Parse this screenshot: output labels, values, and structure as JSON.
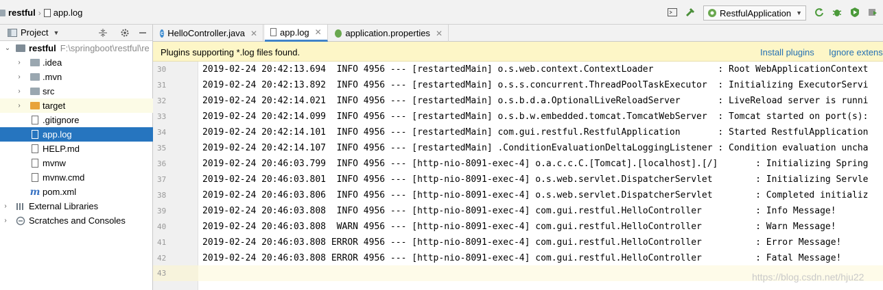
{
  "breadcrumb": {
    "project": "restful",
    "file": "app.log"
  },
  "toolbar": {
    "run_config": "RestfulApplication",
    "icons": [
      "terminal-icon",
      "build-icon",
      "rerun-icon",
      "debug-icon",
      "coverage-icon",
      "stop-icon"
    ]
  },
  "project_panel": {
    "title": "Project",
    "header_icons": [
      "collapse-all-icon",
      "settings-gear-icon",
      "hide-panel-icon"
    ],
    "tree": [
      {
        "label": "restful",
        "path": "F:\\springboot\\restful\\re",
        "icon": "module-folder-icon",
        "expanded": true,
        "level": 0
      },
      {
        "label": ".idea",
        "icon": "folder-icon",
        "level": 1
      },
      {
        "label": ".mvn",
        "icon": "folder-icon",
        "level": 1
      },
      {
        "label": "src",
        "icon": "folder-icon",
        "level": 1
      },
      {
        "label": "target",
        "icon": "folder-excluded-icon",
        "level": 1
      },
      {
        "label": ".gitignore",
        "icon": "file-icon",
        "level": 1
      },
      {
        "label": "app.log",
        "icon": "file-icon",
        "level": 1,
        "selected": true
      },
      {
        "label": "HELP.md",
        "icon": "file-icon",
        "level": 1
      },
      {
        "label": "mvnw",
        "icon": "file-icon",
        "level": 1
      },
      {
        "label": "mvnw.cmd",
        "icon": "file-icon",
        "level": 1
      },
      {
        "label": "pom.xml",
        "icon": "maven-icon",
        "level": 1
      },
      {
        "label": "External Libraries",
        "icon": "libraries-icon",
        "level": 0
      },
      {
        "label": "Scratches and Consoles",
        "icon": "scratches-icon",
        "level": 0
      }
    ]
  },
  "tabs": [
    {
      "label": "HelloController.java",
      "icon": "java-class-icon"
    },
    {
      "label": "app.log",
      "icon": "log-file-icon",
      "active": true
    },
    {
      "label": "application.properties",
      "icon": "spring-properties-icon"
    }
  ],
  "banner": {
    "message": "Plugins supporting *.log files found.",
    "install": "Install plugins",
    "ignore": "Ignore extens"
  },
  "editor": {
    "lines": [
      {
        "num": "30",
        "text": "2019-02-24 20:42:13.694  INFO 4956 --- [restartedMain] o.s.web.context.ContextLoader            : Root WebApplicationContext"
      },
      {
        "num": "31",
        "text": "2019-02-24 20:42:13.892  INFO 4956 --- [restartedMain] o.s.s.concurrent.ThreadPoolTaskExecutor  : Initializing ExecutorServi"
      },
      {
        "num": "32",
        "text": "2019-02-24 20:42:14.021  INFO 4956 --- [restartedMain] o.s.b.d.a.OptionalLiveReloadServer       : LiveReload server is runni"
      },
      {
        "num": "33",
        "text": "2019-02-24 20:42:14.099  INFO 4956 --- [restartedMain] o.s.b.w.embedded.tomcat.TomcatWebServer  : Tomcat started on port(s):"
      },
      {
        "num": "34",
        "text": "2019-02-24 20:42:14.101  INFO 4956 --- [restartedMain] com.gui.restful.RestfulApplication       : Started RestfulApplication"
      },
      {
        "num": "35",
        "text": "2019-02-24 20:42:14.107  INFO 4956 --- [restartedMain] .ConditionEvaluationDeltaLoggingListener : Condition evaluation uncha"
      },
      {
        "num": "36",
        "text": "2019-02-24 20:46:03.799  INFO 4956 --- [http-nio-8091-exec-4] o.a.c.c.C.[Tomcat].[localhost].[/]       : Initializing Spring"
      },
      {
        "num": "37",
        "text": "2019-02-24 20:46:03.801  INFO 4956 --- [http-nio-8091-exec-4] o.s.web.servlet.DispatcherServlet        : Initializing Servle"
      },
      {
        "num": "38",
        "text": "2019-02-24 20:46:03.806  INFO 4956 --- [http-nio-8091-exec-4] o.s.web.servlet.DispatcherServlet        : Completed initializ"
      },
      {
        "num": "39",
        "text": "2019-02-24 20:46:03.808  INFO 4956 --- [http-nio-8091-exec-4] com.gui.restful.HelloController          : Info Message!"
      },
      {
        "num": "40",
        "text": "2019-02-24 20:46:03.808  WARN 4956 --- [http-nio-8091-exec-4] com.gui.restful.HelloController          : Warn Message!"
      },
      {
        "num": "41",
        "text": "2019-02-24 20:46:03.808 ERROR 4956 --- [http-nio-8091-exec-4] com.gui.restful.HelloController          : Error Message!"
      },
      {
        "num": "42",
        "text": "2019-02-24 20:46:03.808 ERROR 4956 --- [http-nio-8091-exec-4] com.gui.restful.HelloController          : Fatal Message!"
      },
      {
        "num": "43",
        "text": ""
      }
    ],
    "watermark": "https://blog.csdn.net/hju22"
  },
  "colors": {
    "selection": "#2675bf",
    "banner_bg": "#fdf6c7",
    "link": "#2470b3",
    "tab_active_underline": "#4083c9"
  }
}
